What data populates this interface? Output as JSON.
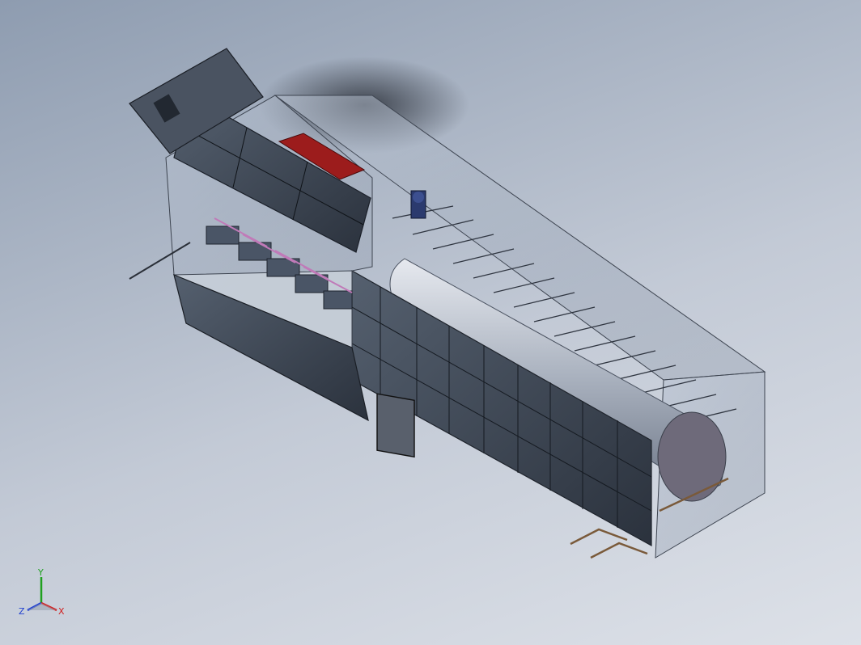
{
  "scene": {
    "background_top": "#8e9cb0",
    "background_bottom": "#dde1e8",
    "model_name": ""
  },
  "triad": {
    "x_label": "X",
    "y_label": "Y",
    "z_label": "Z",
    "x_color": "#d02020",
    "y_color": "#20a020",
    "z_color": "#2040d0"
  }
}
